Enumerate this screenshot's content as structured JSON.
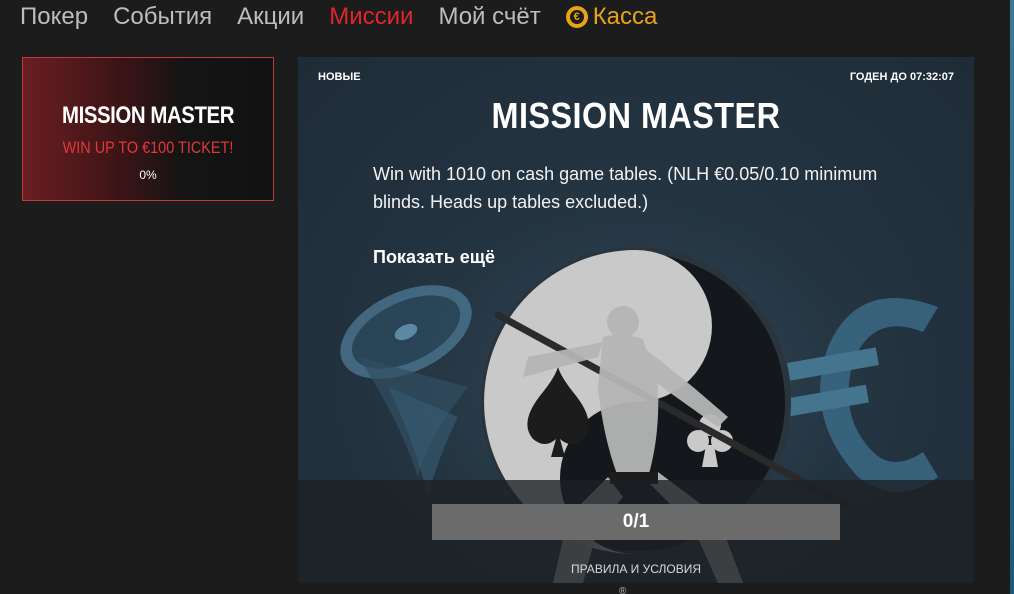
{
  "nav": {
    "items": [
      {
        "label": "Покер"
      },
      {
        "label": "События"
      },
      {
        "label": "Акции"
      },
      {
        "label": "Миссии",
        "active": true
      },
      {
        "label": "Мой счёт"
      },
      {
        "label": "Касса",
        "icon": "coin-icon"
      }
    ]
  },
  "colors": {
    "active_nav": "#e0262c",
    "cashier": "#e8a317",
    "card_border": "#c0393b",
    "card_subtitle": "#e0383d"
  },
  "mission_card": {
    "title": "MISSION MASTER",
    "subtitle": "WIN UP TO €100 TICKET!",
    "progress_text": "0%"
  },
  "panel": {
    "tag": "НОВЫЕ",
    "valid_until": "ГОДЕН ДО 07:32:07",
    "title": "MISSION MASTER",
    "description": "Win with 1010 on cash game tables. (NLH €0.05/0.10 minimum blinds. Heads up tables excluded.)",
    "show_more": "Показать ещё",
    "progress": {
      "label": "0/1",
      "current": 0,
      "target": 1
    },
    "rules_link": "ПРАВИЛА И УСЛОВИЯ"
  },
  "footer": {
    "glyph": "®"
  }
}
